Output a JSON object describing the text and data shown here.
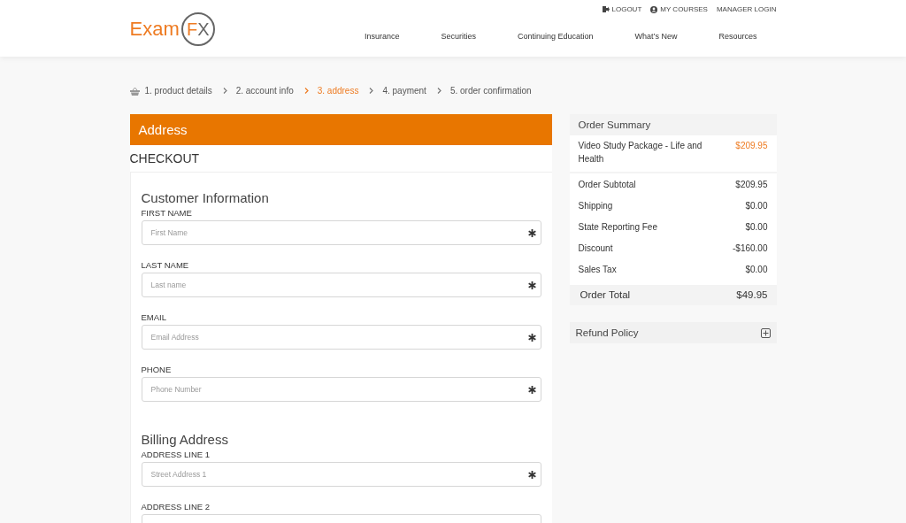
{
  "header": {
    "logo": {
      "word": "Exam",
      "letter_1": "F",
      "letter_2": "X"
    },
    "top_links": [
      "LOGOUT",
      "MY COURSES",
      "MANAGER LOGIN"
    ],
    "nav": [
      "Insurance",
      "Securities",
      "Continuing Education",
      "What’s New",
      "Resources"
    ]
  },
  "steps": [
    {
      "label": "1. product details",
      "selected": false
    },
    {
      "label": "2. account info",
      "selected": false
    },
    {
      "label": "3. address",
      "selected": true
    },
    {
      "label": "4. payment",
      "selected": false
    },
    {
      "label": "5. order confirmation",
      "selected": false
    }
  ],
  "panel_title": "Address",
  "checkout_title": "CHECKOUT",
  "sections": [
    {
      "title": "Customer Information",
      "fields": [
        {
          "label": "FIRST NAME",
          "placeholder": "First Name",
          "required": true
        },
        {
          "label": "LAST NAME",
          "placeholder": "Last name",
          "required": true
        },
        {
          "label": "EMAIL",
          "placeholder": "Email Address",
          "required": true
        },
        {
          "label": "PHONE",
          "placeholder": "Phone Number",
          "required": true
        }
      ]
    },
    {
      "title": "Billing Address",
      "fields": [
        {
          "label": "ADDRESS LINE 1",
          "placeholder": "Street Address 1",
          "required": true
        },
        {
          "label": "ADDRESS LINE 2"
        }
      ]
    }
  ],
  "order_summary": {
    "title": "Order Summary",
    "item": {
      "name": "Video Study Package - Life and Health",
      "price": "$209.95"
    },
    "lines": [
      {
        "label": "Order Subtotal",
        "value": "$209.95"
      },
      {
        "label": "Shipping",
        "value": "$0.00"
      },
      {
        "label": "State Reporting Fee",
        "value": "$0.00"
      },
      {
        "label": "Discount",
        "value": "-$160.00"
      },
      {
        "label": "Sales Tax",
        "value": "$0.00"
      }
    ],
    "total": {
      "label": "Order Total",
      "value": "$49.95"
    }
  },
  "refund_policy": {
    "title": "Refund Policy",
    "expanded": false
  }
}
